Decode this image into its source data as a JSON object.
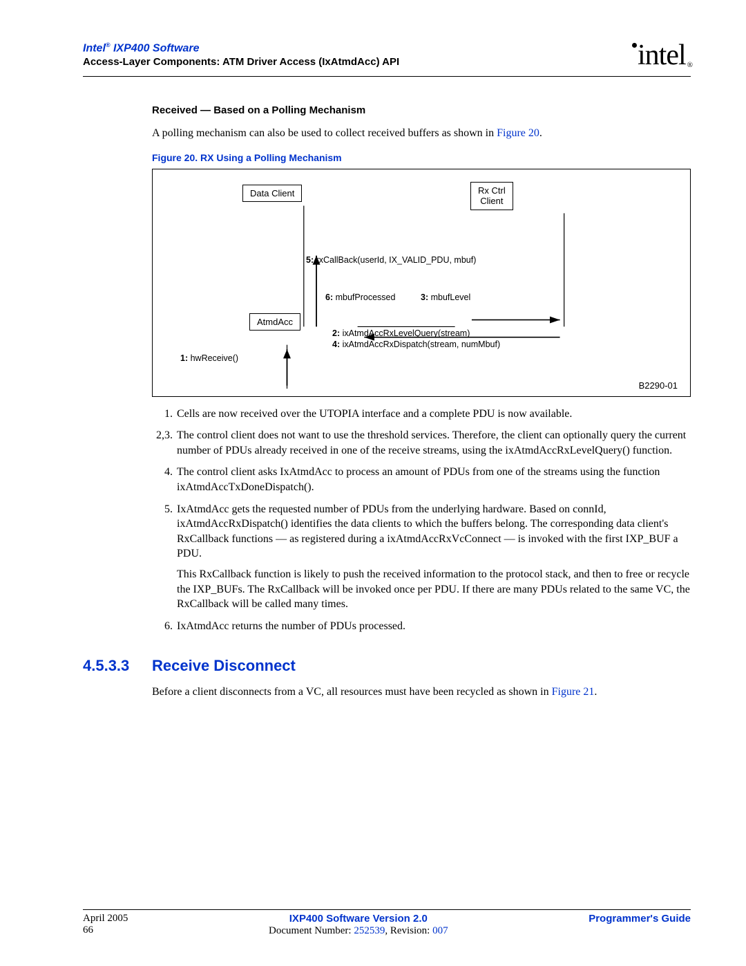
{
  "header": {
    "product_prefix": "Intel",
    "product_reg": "®",
    "product_name": " IXP400 Software",
    "subtitle": "Access-Layer Components: ATM Driver Access (IxAtmdAcc) API",
    "logo_text": "intel",
    "logo_reg": "®"
  },
  "section1": {
    "heading": "Received — Based on a Polling Mechanism",
    "intro_a": "A polling mechanism can also be used to collect received buffers as shown in ",
    "intro_link": "Figure 20",
    "intro_b": "."
  },
  "figure": {
    "caption": "Figure 20. RX Using a Polling Mechanism",
    "box_data_client": "Data Client",
    "box_rx_ctrl1": "Rx Ctrl",
    "box_rx_ctrl2": "Client",
    "box_atmdacc": "AtmdAcc",
    "lbl5b": "5:",
    "lbl5": " rxCallBack(userId, IX_VALID_PDU, mbuf)",
    "lbl6b": "6:",
    "lbl6": " mbufProcessed",
    "lbl3b": "3:",
    "lbl3": " mbufLevel",
    "lbl2b": "2:",
    "lbl2": " ixAtmdAccRxLevelQuery(stream)",
    "lbl4b": "4:",
    "lbl4": " ixAtmdAccRxDispatch(stream, numMbuf)",
    "lbl1b": "1:",
    "lbl1": " hwReceive()",
    "code": "B2290-01"
  },
  "list": {
    "i1n": "1.",
    "i1": "Cells are now received over the UTOPIA interface and a complete PDU is now available.",
    "i23n": "2,3.",
    "i23": "The control client does not want to use the threshold services. Therefore, the client can optionally query the current number of PDUs already received in one of the receive streams, using the ixAtmdAccRxLevelQuery() function.",
    "i4n": "4.",
    "i4": "The control client asks IxAtmdAcc to process an amount of PDUs from one of the streams using the function ixAtmdAccTxDoneDispatch().",
    "i5n": "5.",
    "i5": "IxAtmdAcc gets the requested number of PDUs from the underlying hardware. Based on connId, ixAtmdAccRxDispatch() identifies the data clients to which the buffers belong. The corresponding data client's RxCallback functions — as registered during a ixAtmdAccRxVcConnect — is invoked with the first IXP_BUF a PDU.",
    "i5b": "This RxCallback function is likely to push the received information to the protocol stack, and then to free or recycle the IXP_BUFs. The RxCallback will be invoked once per PDU. If there are many PDUs related to the same VC, the RxCallback will be called many times.",
    "i6n": "6.",
    "i6": "IxAtmdAcc returns the number of PDUs processed."
  },
  "section2": {
    "num": "4.5.3.3",
    "title": "Receive Disconnect",
    "body_a": "Before a client disconnects from a VC, all resources must have been recycled as shown in ",
    "body_link": "Figure 21",
    "body_b": "."
  },
  "footer": {
    "date": "April 2005",
    "page": "66",
    "center_bold": "IXP400 Software Version 2.0",
    "doc_a": "Document Number: ",
    "doc_num": "252539",
    "doc_b": ", Revision: ",
    "doc_rev": "007",
    "guide": "Programmer's Guide"
  }
}
